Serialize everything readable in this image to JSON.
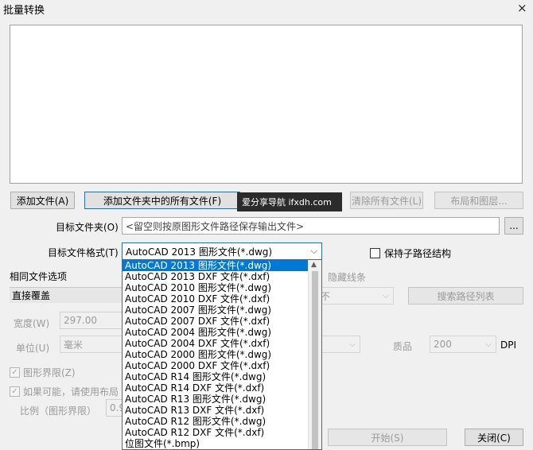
{
  "window": {
    "title": "批量转换"
  },
  "buttons": {
    "add_file": "添加文件(A)",
    "add_folder_files": "添加文件夹中的所有文件(F)",
    "clear_all": "清除所有文件(L)",
    "layouts": "布局和图层...",
    "browse": "...",
    "search_path_list": "搜索路径列表",
    "start": "开始(S)",
    "close": "关闭(C)"
  },
  "watermark": "爱分享导航 ifxdh.com",
  "target_folder": {
    "label": "目标文件夹(O)",
    "placeholder": "<留空则按原图形文件路径保存输出文件>"
  },
  "target_format": {
    "label": "目标文件格式(T)",
    "selected": "AutoCAD 2013 图形文件(*.dwg)"
  },
  "keep_subpath": {
    "label": "保持子路径结构"
  },
  "same_file_options": {
    "label": "相同文件选项",
    "value": "直接覆盖"
  },
  "hidden_line_label": "隐藏线条",
  "left_options": {
    "width_label": "宽度(W)",
    "width_value": "297.00",
    "unit_label": "单位(U)",
    "unit_value": "毫米",
    "graphic_limits": "图形界限(Z)",
    "use_layout": "如果可能，请使用布局",
    "ratio_label": "比例（图形界限）",
    "ratio_value": "0.9"
  },
  "right_options": {
    "combo_partial": "不",
    "quality_label": "质品",
    "quality_value": "200",
    "dpi": "DPI"
  },
  "format_options": [
    "AutoCAD 2013 图形文件(*.dwg)",
    "AutoCAD 2013 DXF 文件(*.dxf)",
    "AutoCAD 2010 图形文件(*.dwg)",
    "AutoCAD 2010 DXF 文件(*.dxf)",
    "AutoCAD 2007 图形文件(*.dwg)",
    "AutoCAD 2007 DXF 文件(*.dxf)",
    "AutoCAD 2004 图形文件(*.dwg)",
    "AutoCAD 2004 DXF 文件(*.dxf)",
    "AutoCAD 2000 图形文件(*.dwg)",
    "AutoCAD 2000 DXF 文件(*.dxf)",
    "AutoCAD R14 图形文件(*.dwg)",
    "AutoCAD R14 DXF 文件(*.dxf)",
    "AutoCAD R13 图形文件(*.dwg)",
    "AutoCAD R13 DXF 文件(*.dxf)",
    "AutoCAD R12 图形文件(*.dwg)",
    "AutoCAD R12 DXF 文件(*.dxf)",
    "位图文件(*.bmp)"
  ],
  "format_selected_index": 0,
  "icons": {
    "close": "×",
    "dropdown_arrow": "⌵",
    "scroll_up": "▲",
    "check": "✓"
  }
}
